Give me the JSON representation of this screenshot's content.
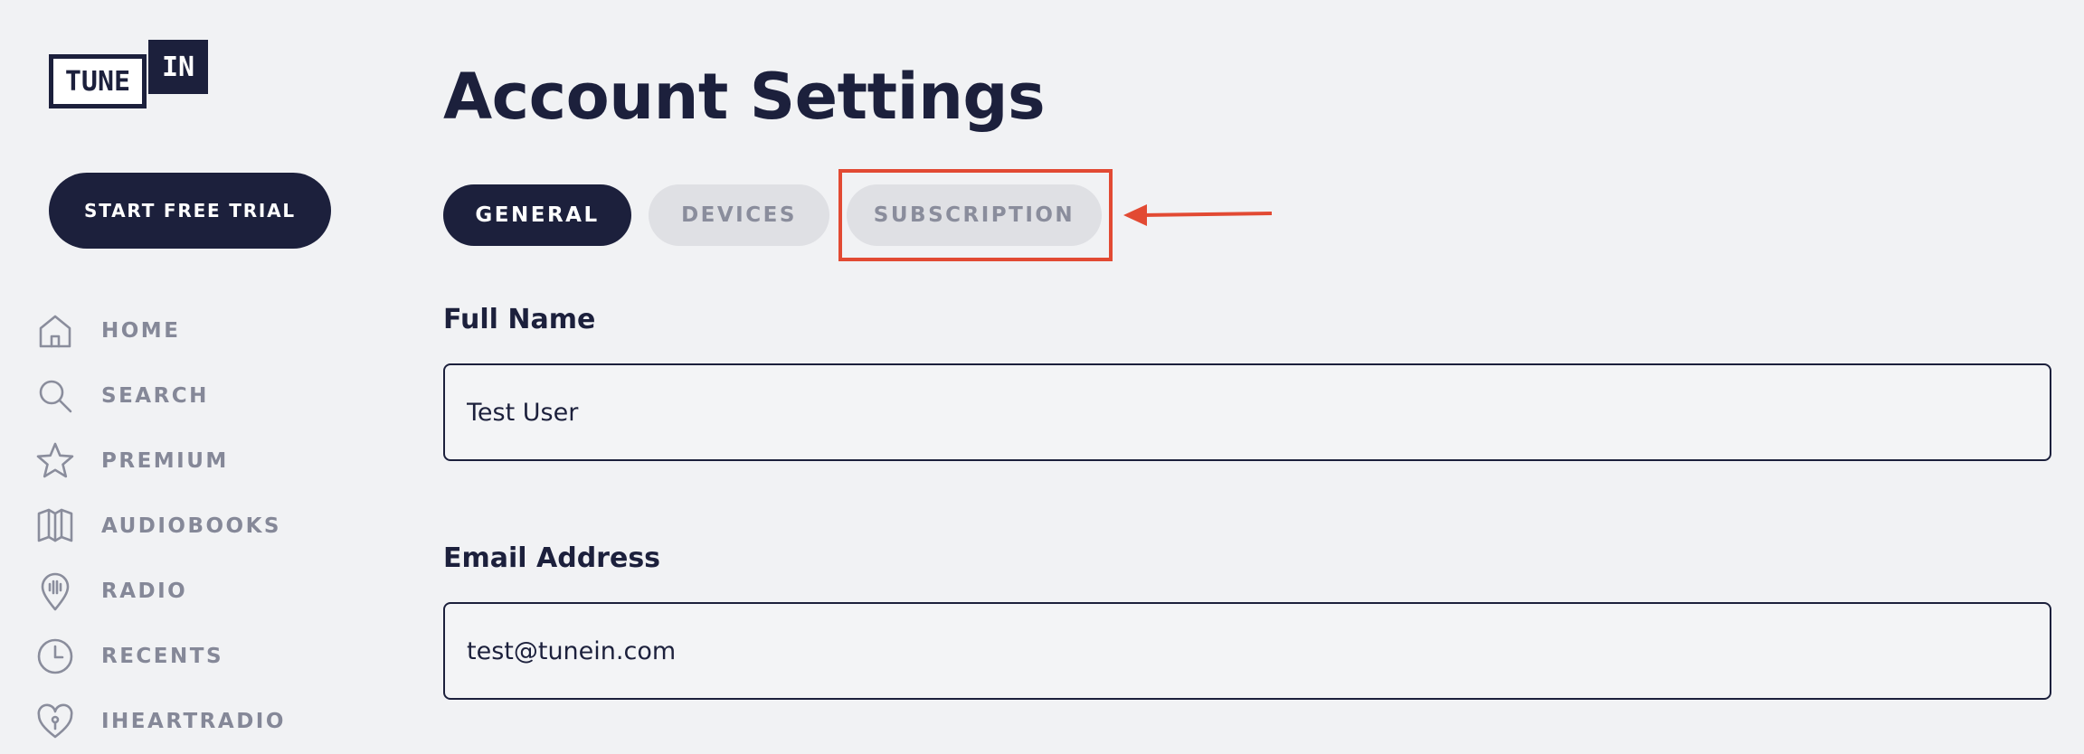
{
  "brand": {
    "logo_left": "TUNE",
    "logo_right": "IN"
  },
  "sidebar": {
    "trial_button": "START FREE TRIAL",
    "items": [
      {
        "label": "HOME",
        "icon": "home-icon"
      },
      {
        "label": "SEARCH",
        "icon": "search-icon"
      },
      {
        "label": "PREMIUM",
        "icon": "star-icon"
      },
      {
        "label": "AUDIOBOOKS",
        "icon": "book-icon"
      },
      {
        "label": "RADIO",
        "icon": "radio-pin-icon"
      },
      {
        "label": "RECENTS",
        "icon": "clock-icon"
      },
      {
        "label": "IHEARTRADIO",
        "icon": "heart-icon"
      }
    ]
  },
  "main": {
    "title": "Account Settings",
    "tabs": [
      {
        "label": "GENERAL",
        "active": true
      },
      {
        "label": "DEVICES",
        "active": false
      },
      {
        "label": "SUBSCRIPTION",
        "active": false
      }
    ],
    "form": {
      "full_name_label": "Full Name",
      "full_name_value": "Test User",
      "email_label": "Email Address",
      "email_value": "test@tunein.com"
    }
  },
  "colors": {
    "primary": "#1c203c",
    "background": "#f1f2f4",
    "inactive_tab": "#dfe0e4",
    "nav_gray": "#858898",
    "annotation": "#e24a33"
  }
}
